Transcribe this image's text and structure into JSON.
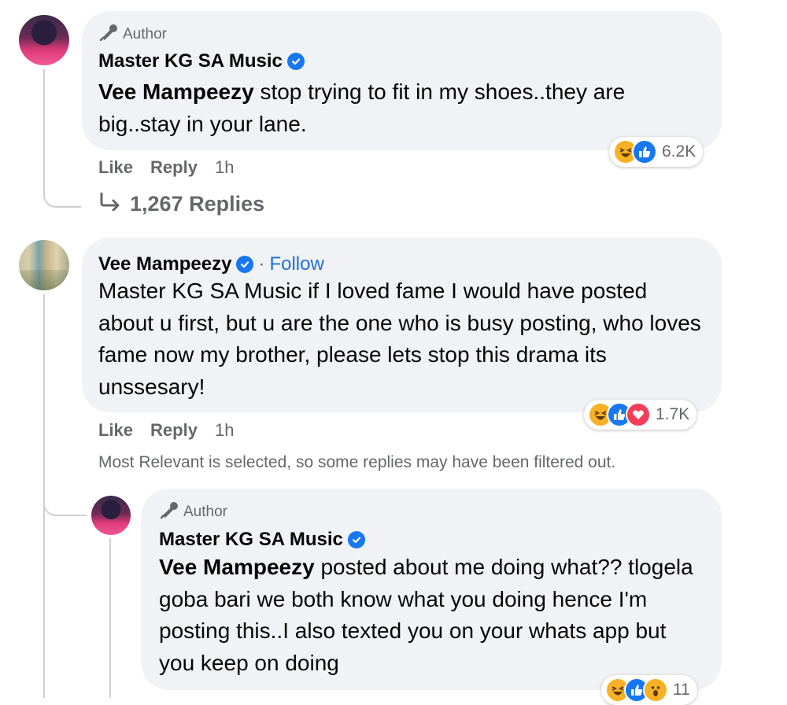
{
  "comments": [
    {
      "author_badge": "Author",
      "name": "Master KG SA Music",
      "mention": "Vee Mampeezy",
      "text": " stop trying to fit in my shoes..they are big..stay in your lane.",
      "actions": {
        "like": "Like",
        "reply": "Reply",
        "time": "1h"
      },
      "reaction_count": "6.2K",
      "reaction_icons": [
        "haha-icon",
        "like-icon"
      ],
      "replies_link": "1,267 Replies"
    },
    {
      "name": "Vee Mampeezy",
      "separator": "·",
      "follow": "Follow",
      "text": "Master KG SA Music if I loved fame I would have posted about u first, but u are the one who is busy posting, who loves fame now my brother, please lets stop this drama its unssesary!",
      "actions": {
        "like": "Like",
        "reply": "Reply",
        "time": "1h"
      },
      "reaction_count": "1.7K",
      "reaction_icons": [
        "haha-icon",
        "like-icon",
        "love-icon"
      ],
      "filter_note": "Most Relevant is selected, so some replies may have been filtered out."
    },
    {
      "author_badge": "Author",
      "name": "Master KG SA Music",
      "mention": "Vee Mampeezy",
      "text": " posted about me doing what?? tlogela goba bari we both know what you doing hence I'm posting this..I also texted you on your whats app but you keep on doing",
      "reaction_count": "11",
      "reaction_icons": [
        "haha-icon",
        "like-icon",
        "wow-icon"
      ]
    }
  ],
  "colors": {
    "bubble": "#f0f2f5",
    "link": "#216fdb",
    "secondary_text": "#65676b",
    "verified": "#1877f2"
  }
}
